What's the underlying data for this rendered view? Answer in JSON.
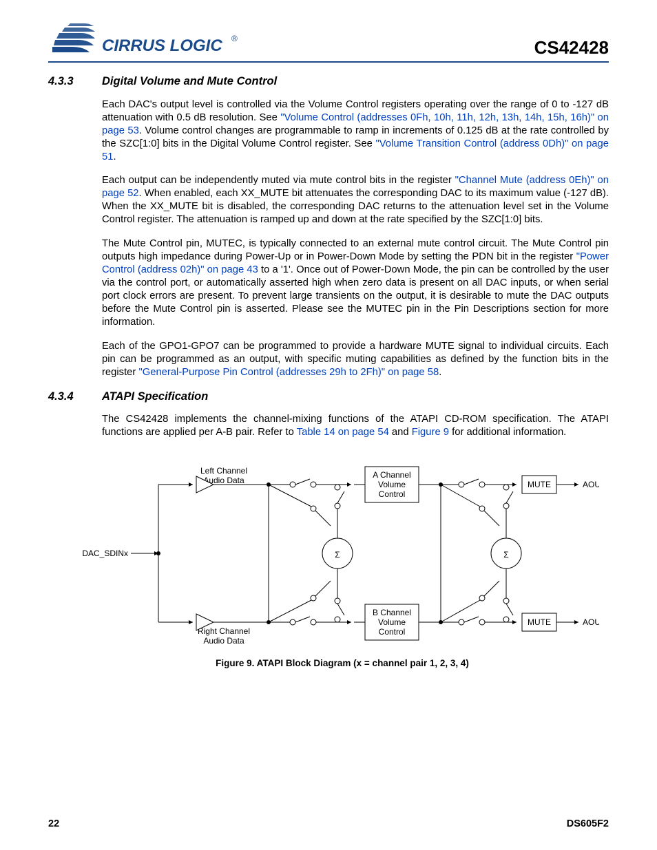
{
  "header": {
    "brand_text": "CIRRUS LOGIC",
    "brand_reg": "®",
    "part_number": "CS42428"
  },
  "section433": {
    "number": "4.3.3",
    "title": "Digital Volume and Mute Control",
    "p1_a": "Each DAC's output level is controlled via the Volume Control registers operating over the range of 0 to -127 dB attenuation with 0.5 dB resolution. See ",
    "p1_link1": "\"Volume Control (addresses 0Fh, 10h, 11h, 12h, 13h, 14h, 15h, 16h)\" on page 53",
    "p1_b": ". Volume control changes are programmable to ramp in increments of 0.125 dB at the rate controlled by the SZC[1:0] bits in the Digital Volume Control register. See ",
    "p1_link2": "\"Volume Transition Control (address 0Dh)\" on page 51",
    "p1_c": ".",
    "p2_a": "Each output can be independently muted via mute control bits in the register ",
    "p2_link1": "\"Channel Mute (address 0Eh)\" on page 52",
    "p2_b": ". When enabled, each XX_MUTE bit attenuates the corresponding DAC to its maximum value (-127 dB). When the XX_MUTE bit is disabled, the corresponding DAC returns to the attenuation level set in the Volume Control register. The attenuation is ramped up and down at the rate specified by the SZC[1:0] bits.",
    "p3_a": "The Mute Control pin, MUTEC, is typically connected to an external mute control circuit. The Mute Control pin outputs high impedance during Power-Up or in Power-Down Mode by setting the PDN bit in the register ",
    "p3_link1": "\"Power Control (address 02h)\" on page 43",
    "p3_b": " to a '1'. Once out of Power-Down Mode, the pin can be controlled by the user via the control port, or automatically asserted high when zero data is present on all DAC inputs, or when serial port clock errors are present. To prevent large transients on the output, it is desirable to mute the DAC outputs before the Mute Control pin is asserted. Please see the MUTEC pin in the Pin Descriptions section for more information.",
    "p4_a": "Each of the GPO1-GPO7 can be programmed to provide a hardware MUTE signal to individual circuits. Each pin can be programmed as an output, with specific muting capabilities as defined by the function bits in the register ",
    "p4_link1": "\"General-Purpose Pin Control (addresses 29h to 2Fh)\" on page 58",
    "p4_b": "."
  },
  "section434": {
    "number": "4.3.4",
    "title": "ATAPI Specification",
    "p1_a": "The CS42428 implements the channel-mixing functions of the ATAPI CD-ROM specification. The ATAPI functions are applied per A-B pair. Refer to ",
    "p1_link1": "Table 14 on page 54",
    "p1_b": " and ",
    "p1_link2": "Figure 9",
    "p1_c": " for additional information."
  },
  "diagram": {
    "input_label": "DAC_SDINx",
    "left_top": "Left Channel",
    "left_top2": "Audio Data",
    "left_bot": "Right Channel",
    "left_bot2": "Audio Data",
    "box_a1": "A Channel",
    "box_a2": "Volume",
    "box_a3": "Control",
    "box_b1": "B Channel",
    "box_b2": "Volume",
    "box_b3": "Control",
    "mute": "MUTE",
    "out_a": "AOUTAx",
    "out_b": "AOUTBx",
    "sigma": "Σ",
    "caption": "Figure 9.  ATAPI Block Diagram (x = channel pair 1, 2, 3, 4)"
  },
  "footer": {
    "page": "22",
    "doc": "DS605F2"
  }
}
